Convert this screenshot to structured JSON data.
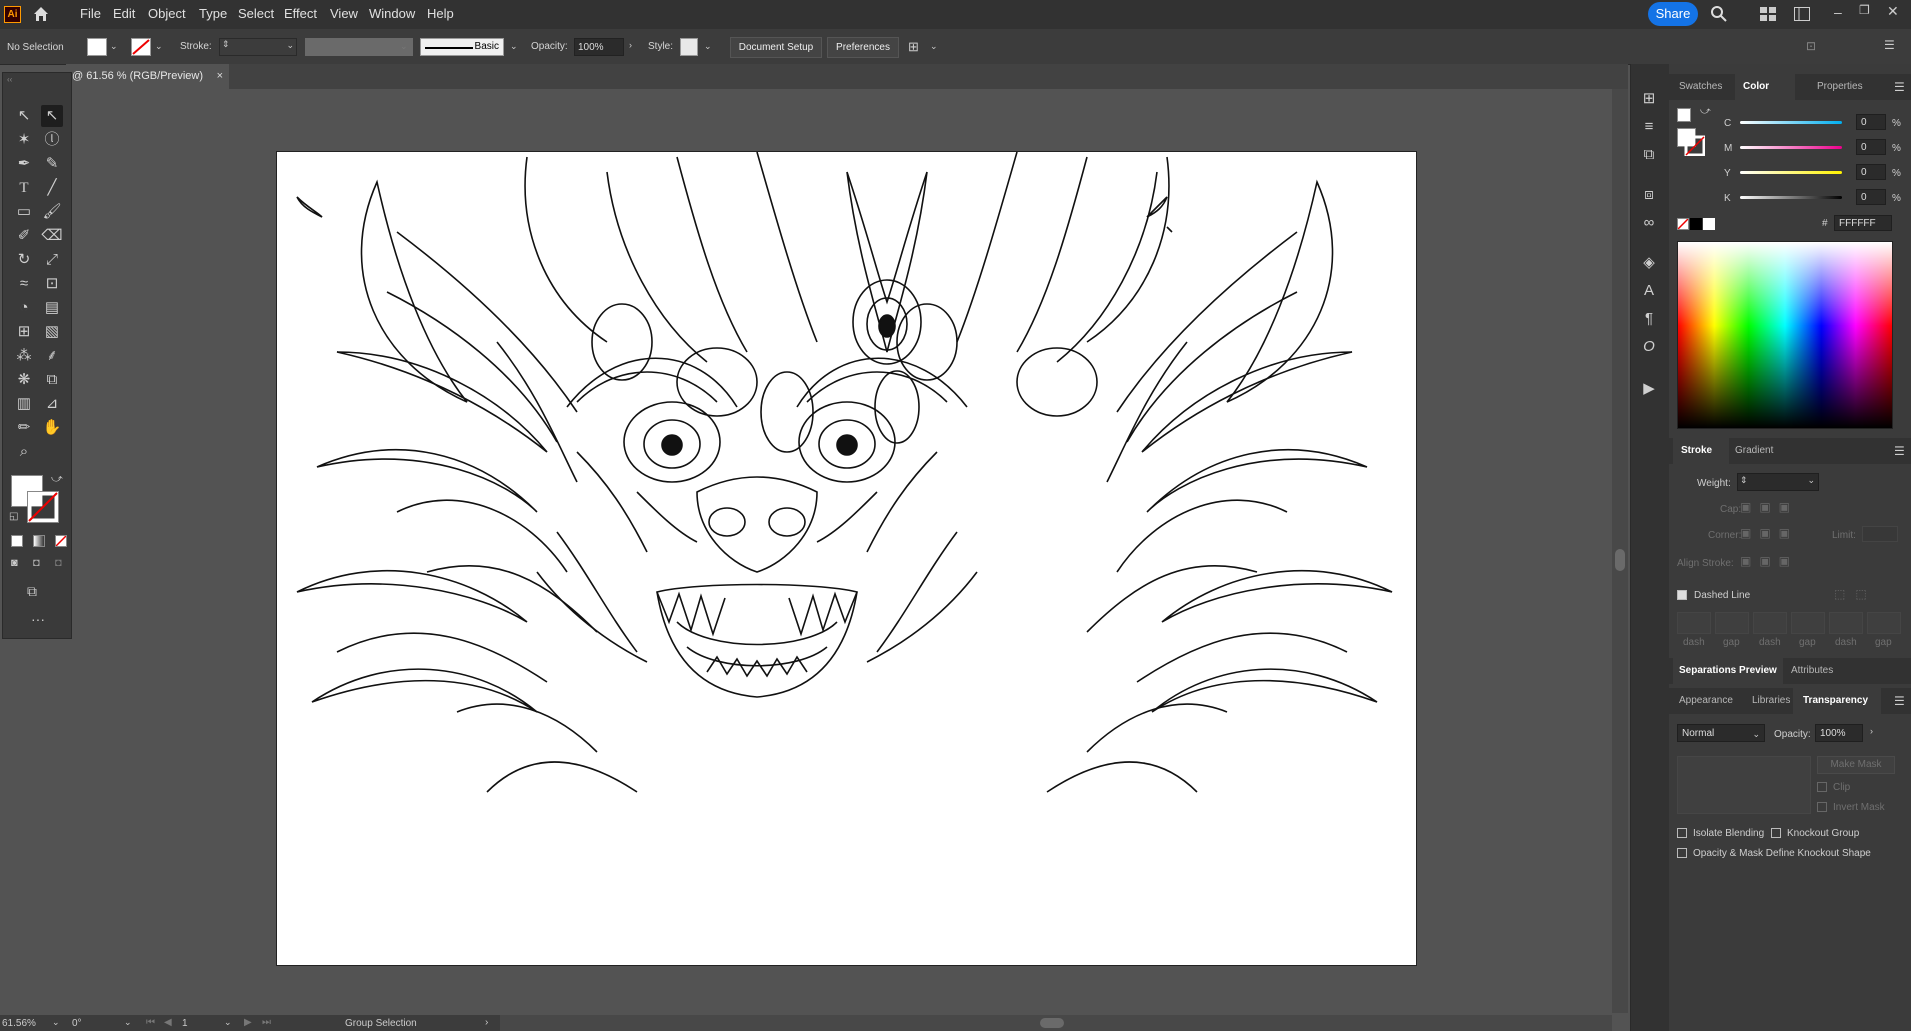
{
  "app": {
    "logo": "Ai"
  },
  "menu": [
    "File",
    "Edit",
    "Object",
    "Type",
    "Select",
    "Effect",
    "View",
    "Window",
    "Help"
  ],
  "topbar": {
    "share_label": "Share"
  },
  "control_bar": {
    "selection_label": "No Selection",
    "stroke_label": "Stroke:",
    "brush_label": "Basic",
    "opacity_label": "Opacity:",
    "opacity_value": "100%",
    "style_label": "Style:",
    "document_setup": "Document Setup",
    "preferences": "Preferences"
  },
  "document_tab": {
    "title": "@ 61.56 % (RGB/Preview)"
  },
  "status_bar": {
    "zoom": "61.56%",
    "rotation": "0°",
    "artboard_number": "1",
    "tool_name": "Group Selection"
  },
  "panels": {
    "top_tabs": [
      "Swatches",
      "Color",
      "Properties"
    ],
    "color": {
      "channels": [
        {
          "label": "C",
          "value": "0",
          "unit": "%"
        },
        {
          "label": "M",
          "value": "0",
          "unit": "%"
        },
        {
          "label": "Y",
          "value": "0",
          "unit": "%"
        },
        {
          "label": "K",
          "value": "0",
          "unit": "%"
        }
      ],
      "hex_value": "FFFFFF"
    },
    "stroke_tabs": [
      "Stroke",
      "Gradient"
    ],
    "stroke": {
      "weight_label": "Weight:",
      "cap_label": "Cap:",
      "corner_label": "Corner:",
      "limit_label": "Limit:",
      "align_label": "Align Stroke:",
      "dashed_label": "Dashed Line",
      "dash_labels": [
        "dash",
        "gap",
        "dash",
        "gap",
        "dash",
        "gap"
      ]
    },
    "sep_tabs": [
      "Separations Preview",
      "Attributes"
    ],
    "trans_tabs": [
      "Appearance",
      "Libraries",
      "Transparency"
    ],
    "transparency": {
      "blend_mode": "Normal",
      "opacity_label": "Opacity:",
      "opacity_value": "100%",
      "make_mask": "Make Mask",
      "clip": "Clip",
      "invert_mask": "Invert Mask",
      "isolate_blending": "Isolate Blending",
      "knockout_group": "Knockout Group",
      "opacity_mask_define": "Opacity & Mask Define Knockout Shape"
    }
  },
  "colors": {
    "accent": "#1473e6",
    "app_bg": "#535353",
    "panel_bg": "#3b3b3b"
  }
}
